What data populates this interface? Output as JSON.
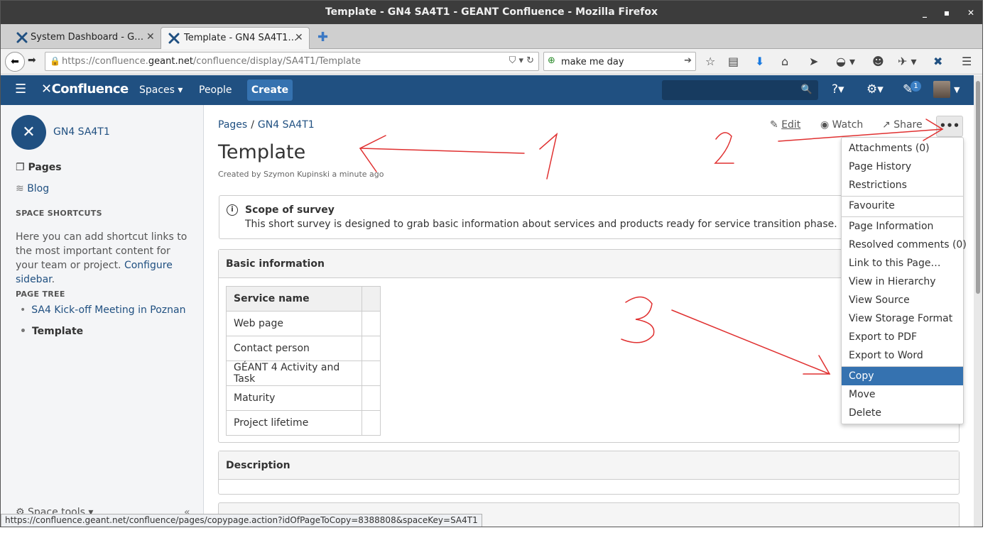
{
  "window": {
    "title": "Template - GN4 SA4T1 - GEANT Confluence - Mozilla Firefox",
    "minimize": "_",
    "maximize": "▪",
    "close": "✕"
  },
  "tabs": [
    {
      "label": "System Dashboard - G…",
      "close": "✕"
    },
    {
      "label": "Template - GN4 SA4T1…",
      "close": "✕"
    }
  ],
  "newtab": "✚",
  "nav": {
    "url_prefix": "https://confluence.",
    "url_domain": "geant.net",
    "url_path": "/confluence/display/SA4T1/Template",
    "search_value": "make me day",
    "back": "⬅",
    "forward": "➡"
  },
  "confluence": {
    "brand": "Confluence",
    "spaces": "Spaces ▾",
    "people": "People",
    "create": "Create",
    "notifications": "1",
    "colors": {
      "header": "#205081",
      "create": "#3572b0",
      "link": "#205081",
      "menu_active": "#3572b0"
    }
  },
  "sidebar": {
    "space_name": "GN4 SA4T1",
    "pages": "Pages",
    "blog": "Blog",
    "shortcuts_heading": "SPACE SHORTCUTS",
    "shortcuts_text": "Here you can add shortcut links to the most important content for your team or project. ",
    "configure_link": "Configure sidebar",
    "shortcuts_end": ".",
    "tree_heading": "PAGE TREE",
    "tree": [
      "SA4 Kick-off Meeting in Poznan",
      "Template"
    ],
    "space_tools": "Space tools ▾",
    "collapse": "«"
  },
  "page": {
    "breadcrumb": [
      "Pages",
      "GN4 SA4T1"
    ],
    "breadcrumb_sep": "/",
    "title": "Template",
    "byline_prefix": "Created by ",
    "byline_author": "Szymon Kupinski",
    "byline_suffix": " a minute ago",
    "actions": {
      "edit": "Edit",
      "watch": "Watch",
      "share": "Share",
      "more": "•••"
    },
    "info_title": "Scope of survey",
    "info_body": "This short survey is designed to grab basic information about services and products ready for service transition phase.",
    "section_basic": "Basic information",
    "table_header": "Service name",
    "table_rows": [
      "Web page",
      "Contact person",
      "GÉANT 4 Activity and Task",
      "Maturity",
      "Project lifetime"
    ],
    "section_desc": "Description"
  },
  "more_menu": {
    "group1": [
      "Attachments (0)",
      "Page History",
      "Restrictions"
    ],
    "group2": [
      "Favourite"
    ],
    "group3": [
      "Page Information",
      "Resolved comments (0)",
      "Link to this Page…",
      "View in Hierarchy",
      "View Source",
      "View Storage Format",
      "Export to PDF",
      "Export to Word"
    ],
    "group4": [
      "Copy",
      "Move",
      "Delete"
    ],
    "active_item": "Copy"
  },
  "status_url": "https://confluence.geant.net/confluence/pages/copypage.action?idOfPageToCopy=8388808&spaceKey=SA4T1",
  "annotation_color": "#e03030"
}
